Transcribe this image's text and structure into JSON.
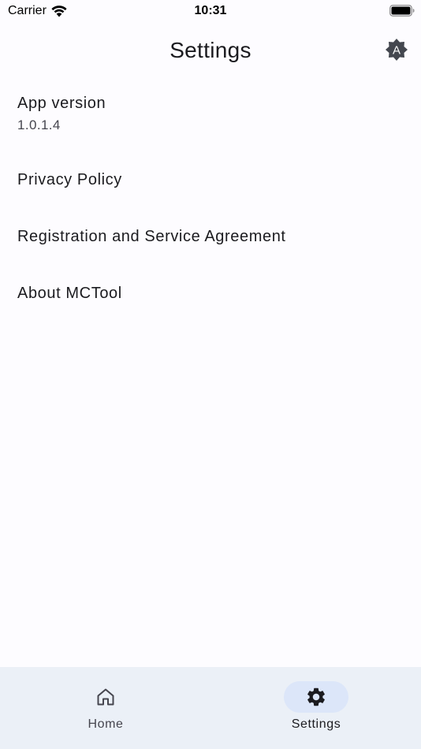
{
  "status_bar": {
    "carrier": "Carrier",
    "time": "10:31",
    "wifi_icon": "wifi-icon",
    "battery_icon": "battery-full-icon"
  },
  "app_bar": {
    "title": "Settings",
    "theme_icon": "auto-brightness-icon",
    "theme_icon_letter": "A"
  },
  "settings": {
    "app_version": {
      "title": "App version",
      "value": "1.0.1.4"
    },
    "privacy_policy": {
      "title": "Privacy Policy"
    },
    "agreement": {
      "title": "Registration and Service Agreement"
    },
    "about": {
      "title": "About MCTool"
    }
  },
  "bottom_nav": {
    "items": [
      {
        "label": "Home",
        "icon": "home-icon",
        "selected": false
      },
      {
        "label": "Settings",
        "icon": "gear-icon",
        "selected": true
      }
    ]
  },
  "colors": {
    "background": "#fdfcff",
    "nav_background": "#ebf0f7",
    "nav_indicator": "#dce6f9",
    "text_primary": "#1b1b1f",
    "text_secondary": "#46464f"
  }
}
